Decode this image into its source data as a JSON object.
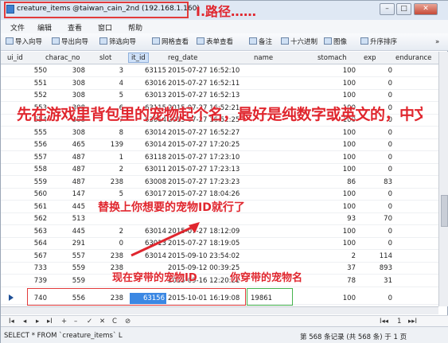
{
  "window": {
    "title": "creature_items @taiwan_cain_2nd (192.168.1.160)",
    "title_overlay": "I.路径……",
    "minimize": "–",
    "maximize": "□",
    "close": "✕"
  },
  "menu": [
    "文件",
    "编辑",
    "查看",
    "窗口",
    "帮助"
  ],
  "toolbar": {
    "import": "导入向导",
    "export": "导出向导",
    "filter": "筛选向导",
    "grid_view": "网格查看",
    "form_view": "表单查看",
    "memo": "备注",
    "hex": "十六进制",
    "image": "图像",
    "sort": "升序排序",
    "more": "»"
  },
  "columns": [
    "ui_id",
    "charac_no",
    "slot",
    "it_id",
    "reg_date",
    "name",
    "stomach",
    "exp",
    "endurance"
  ],
  "rows": [
    [
      "550",
      "308",
      "3",
      "63115",
      "2015-07-27 16:52:10",
      "",
      "100",
      "0",
      ""
    ],
    [
      "551",
      "308",
      "4",
      "63016",
      "2015-07-27 16:52:11",
      "",
      "100",
      "0",
      ""
    ],
    [
      "552",
      "308",
      "5",
      "63013",
      "2015-07-27 16:52:13",
      "",
      "100",
      "0",
      ""
    ],
    [
      "553",
      "308",
      "6",
      "63115",
      "2015-07-27 16:52:21",
      "",
      "100",
      "0",
      ""
    ],
    [
      "554",
      "308",
      "7",
      "63014",
      "2015-07-27 16:52:25",
      "",
      "100",
      "0",
      ""
    ],
    [
      "555",
      "308",
      "8",
      "63014",
      "2015-07-27 16:52:27",
      "",
      "100",
      "0",
      ""
    ],
    [
      "556",
      "465",
      "139",
      "63014",
      "2015-07-27 17:20:25",
      "",
      "100",
      "0",
      ""
    ],
    [
      "557",
      "487",
      "1",
      "63118",
      "2015-07-27 17:23:10",
      "",
      "100",
      "0",
      ""
    ],
    [
      "558",
      "487",
      "2",
      "63011",
      "2015-07-27 17:23:13",
      "",
      "100",
      "0",
      ""
    ],
    [
      "559",
      "487",
      "238",
      "63008",
      "2015-07-27 17:23:23",
      "",
      "86",
      "83",
      ""
    ],
    [
      "560",
      "147",
      "5",
      "63017",
      "2015-07-27 18:04:26",
      "",
      "100",
      "0",
      ""
    ],
    [
      "561",
      "445",
      "",
      "",
      "",
      "",
      "100",
      "0",
      ""
    ],
    [
      "562",
      "513",
      "",
      "",
      "",
      "",
      "93",
      "70",
      ""
    ],
    [
      "563",
      "445",
      "2",
      "63014",
      "2015-07-27 18:12:09",
      "",
      "100",
      "0",
      ""
    ],
    [
      "564",
      "291",
      "0",
      "63013",
      "2015-07-27 18:19:05",
      "",
      "100",
      "0",
      ""
    ],
    [
      "567",
      "557",
      "238",
      "63014",
      "2015-09-10 23:54:02",
      "",
      "2",
      "114",
      ""
    ],
    [
      "733",
      "559",
      "238",
      "",
      "2015-09-12 00:39:25",
      "",
      "37",
      "893",
      ""
    ],
    [
      "739",
      "559",
      "",
      "",
      "2015-09-16 12:20:21",
      "",
      "78",
      "31",
      ""
    ],
    [
      "740",
      "556",
      "238",
      "63156",
      "2015-10-01 16:19:08",
      "19861",
      "100",
      "0",
      ""
    ]
  ],
  "status": {
    "sql": "SELECT * FROM `creature_items` L",
    "count": "第 568 条记录 (共 568 条) 于 1 页"
  },
  "nav": {
    "first": "I◂",
    "prev": "◂",
    "next": "▸",
    "last": "▸I",
    "add": "+",
    "delete": "–",
    "confirm": "✓",
    "cancel": "✕",
    "refresh": "C",
    "stop": "⊘",
    "page": "1",
    "page_first": "I◂◂",
    "page_last": "▸▸I"
  },
  "annotations": {
    "main": "先在游戏里背包里的宠物起个名，最好是纯数字或英文的，中文打开是乱码……",
    "replace": "替换上你想要的宠物ID就行了",
    "current_id": "现在穿带的宠物ID",
    "current_name": "你穿带的宠物名"
  },
  "colors": {
    "annotation": "#e0262e",
    "selected_cell": "#3b88e3",
    "name_box": "#46b34d"
  }
}
